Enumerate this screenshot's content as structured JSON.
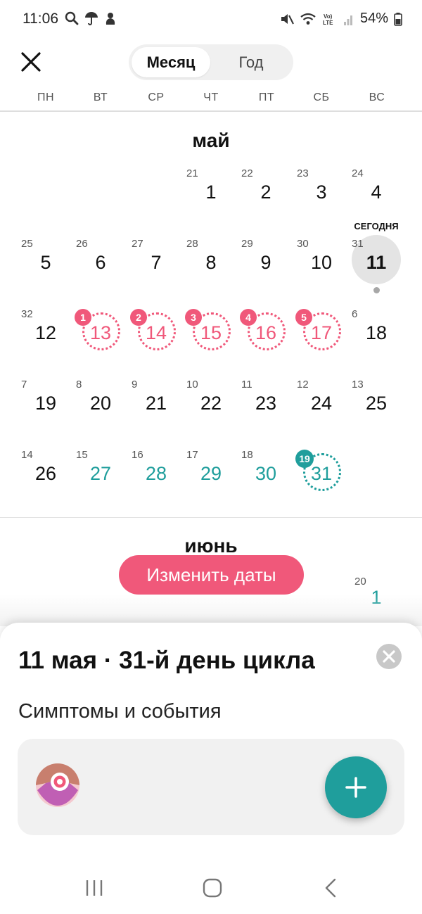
{
  "status_bar": {
    "time": "11:06",
    "battery": "54%",
    "left_icons": [
      "search-icon",
      "umbrella-icon",
      "app-notification-icon"
    ],
    "right_icons": [
      "mute-icon",
      "wifi-icon",
      "volte-icon",
      "signal-icon",
      "battery-icon"
    ]
  },
  "header": {
    "close_icon": "close-icon",
    "tabs": [
      {
        "label": "Месяц",
        "selected": true
      },
      {
        "label": "Год",
        "selected": false
      }
    ]
  },
  "weekdays": [
    "ПН",
    "ВТ",
    "СР",
    "ЧТ",
    "ПТ",
    "СБ",
    "ВС"
  ],
  "calendar": {
    "may": {
      "title": "май",
      "today_label": "СЕГОДНЯ",
      "days": [
        {
          "day": "1",
          "cycle": "21"
        },
        {
          "day": "2",
          "cycle": "22"
        },
        {
          "day": "3",
          "cycle": "23"
        },
        {
          "day": "4",
          "cycle": "24"
        },
        {
          "day": "5",
          "cycle": "25"
        },
        {
          "day": "6",
          "cycle": "26"
        },
        {
          "day": "7",
          "cycle": "27"
        },
        {
          "day": "8",
          "cycle": "28"
        },
        {
          "day": "9",
          "cycle": "29"
        },
        {
          "day": "10",
          "cycle": "30"
        },
        {
          "day": "11",
          "cycle": "31"
        },
        {
          "day": "12",
          "cycle": "32"
        },
        {
          "day": "13",
          "badge": "1"
        },
        {
          "day": "14",
          "badge": "2"
        },
        {
          "day": "15",
          "badge": "3"
        },
        {
          "day": "16",
          "badge": "4"
        },
        {
          "day": "17",
          "badge": "5"
        },
        {
          "day": "18",
          "cycle": "6"
        },
        {
          "day": "19",
          "cycle": "7"
        },
        {
          "day": "20",
          "cycle": "8"
        },
        {
          "day": "21",
          "cycle": "9"
        },
        {
          "day": "22",
          "cycle": "10"
        },
        {
          "day": "23",
          "cycle": "11"
        },
        {
          "day": "24",
          "cycle": "12"
        },
        {
          "day": "25",
          "cycle": "13"
        },
        {
          "day": "26",
          "cycle": "14"
        },
        {
          "day": "27",
          "cycle": "15"
        },
        {
          "day": "28",
          "cycle": "16"
        },
        {
          "day": "29",
          "cycle": "17"
        },
        {
          "day": "30",
          "cycle": "18"
        },
        {
          "day": "31",
          "badge": "19"
        }
      ]
    },
    "june": {
      "title": "июнь",
      "first_day": {
        "day": "1",
        "cycle": "20"
      }
    }
  },
  "change_dates_button": "Изменить даты",
  "sheet": {
    "title": "11 мая · 31-й день цикла",
    "subtitle": "Симптомы и события",
    "symptom_icon": "period-symptom-icon",
    "add_icon": "plus-icon",
    "close_icon": "close-circle-icon"
  },
  "colors": {
    "period": "#f0587a",
    "fertile": "#1f9e9c",
    "today_circle": "#e4e4e4"
  },
  "nav_bar": [
    "recent-apps-icon",
    "home-icon",
    "back-icon"
  ]
}
